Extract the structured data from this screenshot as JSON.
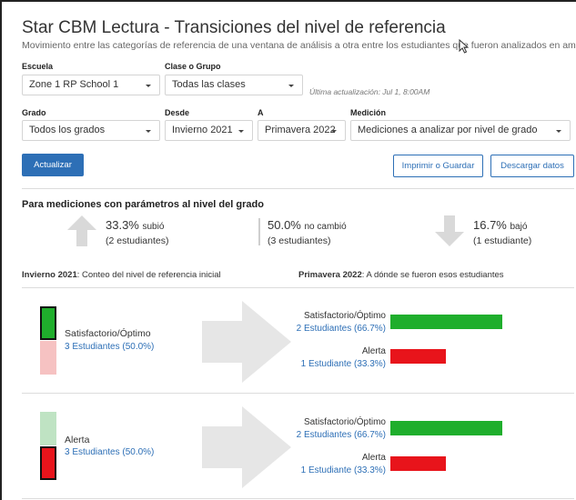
{
  "header": {
    "title": "Star CBM Lectura - Transiciones del nivel de referencia",
    "subtitle": "Movimiento entre las categorías de referencia de una ventana de análisis a otra entre los estudiantes que fueron analizados en ambas"
  },
  "filters": {
    "school_label": "Escuela",
    "school_value": "Zone 1 RP School 1",
    "class_label": "Clase o Grupo",
    "class_value": "Todas las clases",
    "last_updated": "Última actualización: Jul 1, 8:00AM",
    "grade_label": "Grado",
    "grade_value": "Todos los grados",
    "from_label": "Desde",
    "from_value": "Invierno 2021",
    "to_label": "A",
    "to_value": "Primavera 2022",
    "measure_label": "Medición",
    "measure_value": "Mediciones a analizar por nivel de grado"
  },
  "actions": {
    "update": "Actualizar",
    "print": "Imprimir o Guardar",
    "download": "Descargar datos"
  },
  "summary": {
    "heading": "Para mediciones con parámetros al nivel del grado",
    "up_pct": "33.3%",
    "up_word": "subió",
    "up_count": "(2 estudiantes)",
    "same_pct": "50.0%",
    "same_word": "no cambió",
    "same_count": "(3 estudiantes)",
    "down_pct": "16.7%",
    "down_word": "bajó",
    "down_count": "(1 estudiante)"
  },
  "columns": {
    "left_term": "Invierno 2021",
    "left_text": ": Conteo del nivel de referencia inicial",
    "right_term": "Primavera 2022",
    "right_text": ": A dónde se fueron esos estudiantes"
  },
  "groups": [
    {
      "name": "Satisfactorio/Óptimo",
      "count": "3 Estudiantes (50.0%)",
      "destinations": [
        {
          "name": "Satisfactorio/Óptimo",
          "count": "2 Estudiantes (66.7%)",
          "share": 0.667
        },
        {
          "name": "Alerta",
          "count": "1 Estudiante (33.3%)",
          "share": 0.333
        }
      ]
    },
    {
      "name": "Alerta",
      "count": "3 Estudiantes (50.0%)",
      "destinations": [
        {
          "name": "Satisfactorio/Óptimo",
          "count": "2 Estudiantes (66.7%)",
          "share": 0.667
        },
        {
          "name": "Alerta",
          "count": "1 Estudiante (33.3%)",
          "share": 0.333
        }
      ]
    }
  ],
  "colors": {
    "accent": "#2d6fb6",
    "green": "#1fae2c",
    "red": "#e8141b",
    "green_light": "#bfe3c3",
    "red_light": "#f6c2c2",
    "arrow_gray": "#d9d9d9"
  }
}
